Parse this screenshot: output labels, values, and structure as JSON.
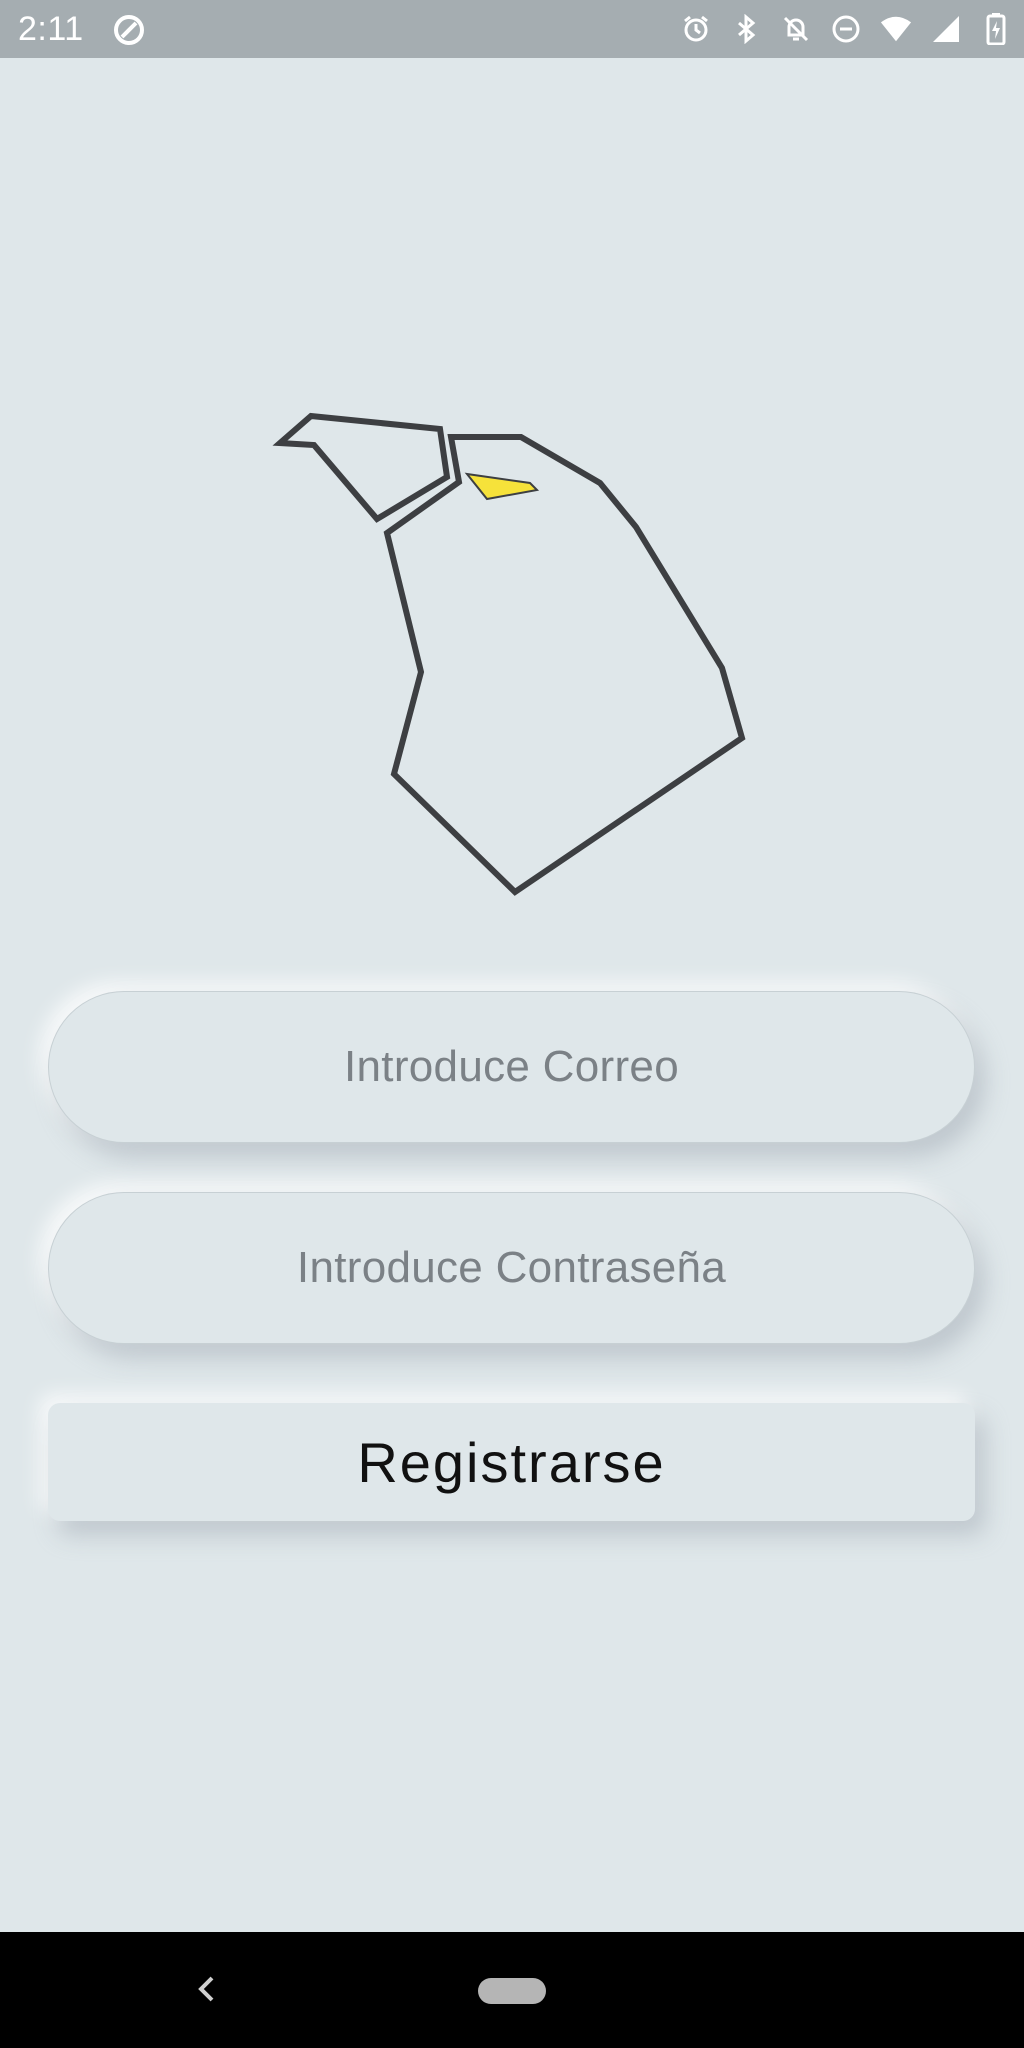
{
  "status_bar": {
    "time": "2:11",
    "left_icon": "data-saver-icon",
    "right_icons": [
      "alarm-icon",
      "bluetooth-icon",
      "notifications-off-icon",
      "do-not-disturb-icon",
      "wifi-icon",
      "cellular-signal-icon",
      "battery-charging-icon"
    ]
  },
  "logo": {
    "icon": "penguin-logo",
    "colors": {
      "outline": "#3d3f42",
      "beak": "#f6e23a"
    }
  },
  "form": {
    "email_placeholder": "Introduce Correo",
    "password_placeholder": "Introduce Contraseña",
    "register_label": "Registrarse"
  },
  "nav_bar": {
    "back_icon": "back-chevron-icon",
    "home_icon": "home-pill-icon"
  },
  "colors": {
    "background": "#dfe7ea",
    "status_bar": "#a5adb1",
    "nav_bar": "#000000"
  }
}
